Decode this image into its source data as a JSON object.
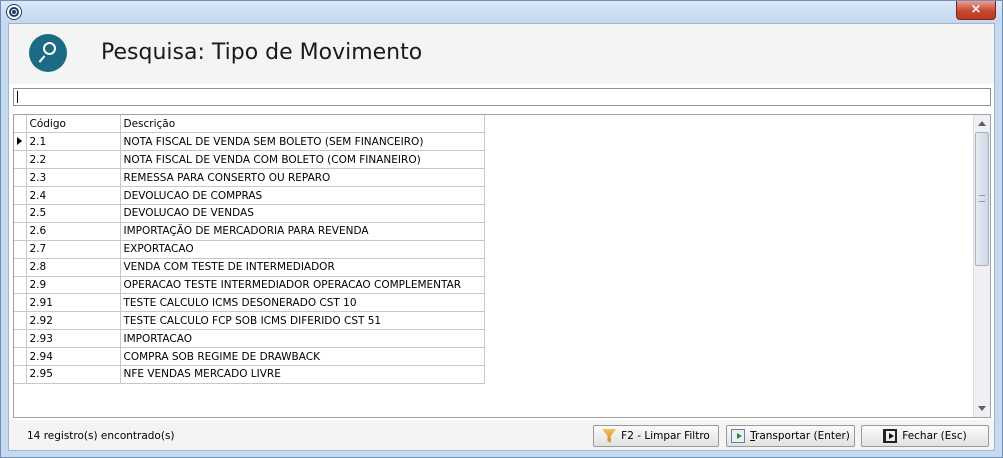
{
  "window": {
    "close_glyph": "×"
  },
  "header": {
    "title": "Pesquisa: Tipo de Movimento"
  },
  "filter": {
    "value": ""
  },
  "grid": {
    "columns": [
      "Código",
      "Descrição"
    ],
    "selected_index": 0,
    "rows": [
      {
        "code": "2.1",
        "desc": "NOTA FISCAL DE VENDA SEM BOLETO (SEM FINANCEIRO)"
      },
      {
        "code": "2.2",
        "desc": "NOTA FISCAL DE VENDA COM BOLETO (COM FINANEIRO)"
      },
      {
        "code": "2.3",
        "desc": "REMESSA PARA CONSERTO OU REPARO"
      },
      {
        "code": "2.4",
        "desc": "DEVOLUCAO DE COMPRAS"
      },
      {
        "code": "2.5",
        "desc": "DEVOLUCAO DE VENDAS"
      },
      {
        "code": "2.6",
        "desc": "IMPORTAÇÃO DE MERCADORIA PARA REVENDA"
      },
      {
        "code": "2.7",
        "desc": "EXPORTACAO"
      },
      {
        "code": "2.8",
        "desc": "VENDA COM TESTE DE INTERMEDIADOR"
      },
      {
        "code": "2.9",
        "desc": "OPERACAO TESTE INTERMEDIADOR OPERACAO COMPLEMENTAR"
      },
      {
        "code": "2.91",
        "desc": "TESTE CALCULO ICMS DESONERADO CST 10"
      },
      {
        "code": "2.92",
        "desc": "TESTE CALCULO FCP SOB ICMS DIFERIDO CST 51"
      },
      {
        "code": "2.93",
        "desc": "IMPORTACAO"
      },
      {
        "code": "2.94",
        "desc": "COMPRA SOB REGIME DE DRAWBACK"
      },
      {
        "code": "2.95",
        "desc": "NFE VENDAS MERCADO LIVRE"
      }
    ]
  },
  "footer": {
    "status": "14 registro(s) encontrado(s)",
    "clear_filter": "F2 - Limpar Filtro",
    "transport_mnemonic": "T",
    "transport_rest": "ransportar (Enter)",
    "close": "Fechar (Esc)"
  },
  "icons": {
    "app": "app-logo-icon",
    "search": "search-icon",
    "clear_filter": "filter-clear-icon",
    "transport": "transport-icon",
    "close": "exit-icon"
  },
  "colors": {
    "accent": "#1b6b85",
    "window_frame": "#c5d9ef",
    "close_button": "#c7462f"
  }
}
